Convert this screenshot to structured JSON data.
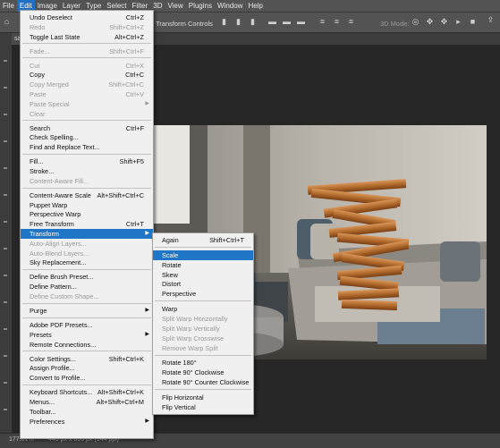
{
  "menubar": [
    "File",
    "Edit",
    "Image",
    "Layer",
    "Type",
    "Select",
    "Filter",
    "3D",
    "View",
    "Plugins",
    "Window",
    "Help"
  ],
  "menubar_active_index": 1,
  "optionsbar": {
    "transform_controls_label": "Transform Controls",
    "mode_3d_label": "3D Mode:"
  },
  "tab": {
    "label": "sa"
  },
  "status": {
    "zoom": "177.01%",
    "doc_info": "440 px x 303 px (144 ppi)"
  },
  "edit_menu": [
    {
      "label": "Undo Deselect",
      "shortcut": "Ctrl+Z",
      "disabled": false
    },
    {
      "label": "Redo",
      "shortcut": "Shift+Ctrl+Z",
      "disabled": true
    },
    {
      "label": "Toggle Last State",
      "shortcut": "Alt+Ctrl+Z",
      "disabled": false
    },
    {
      "sep": true
    },
    {
      "label": "Fade...",
      "shortcut": "Shift+Ctrl+F",
      "disabled": true
    },
    {
      "sep": true
    },
    {
      "label": "Cut",
      "shortcut": "Ctrl+X",
      "disabled": true
    },
    {
      "label": "Copy",
      "shortcut": "Ctrl+C",
      "disabled": false
    },
    {
      "label": "Copy Merged",
      "shortcut": "Shift+Ctrl+C",
      "disabled": true
    },
    {
      "label": "Paste",
      "shortcut": "Ctrl+V",
      "disabled": true
    },
    {
      "label": "Paste Special",
      "shortcut": "",
      "disabled": true,
      "submenu": true
    },
    {
      "label": "Clear",
      "shortcut": "",
      "disabled": true
    },
    {
      "sep": true
    },
    {
      "label": "Search",
      "shortcut": "Ctrl+F",
      "disabled": false
    },
    {
      "label": "Check Spelling...",
      "shortcut": "",
      "disabled": false
    },
    {
      "label": "Find and Replace Text...",
      "shortcut": "",
      "disabled": false
    },
    {
      "sep": true
    },
    {
      "label": "Fill...",
      "shortcut": "Shift+F5",
      "disabled": false
    },
    {
      "label": "Stroke...",
      "shortcut": "",
      "disabled": false
    },
    {
      "label": "Content-Aware Fill...",
      "shortcut": "",
      "disabled": true
    },
    {
      "sep": true
    },
    {
      "label": "Content-Aware Scale",
      "shortcut": "Alt+Shift+Ctrl+C",
      "disabled": false
    },
    {
      "label": "Puppet Warp",
      "shortcut": "",
      "disabled": false
    },
    {
      "label": "Perspective Warp",
      "shortcut": "",
      "disabled": false
    },
    {
      "label": "Free Transform",
      "shortcut": "Ctrl+T",
      "disabled": false
    },
    {
      "label": "Transform",
      "shortcut": "",
      "disabled": false,
      "submenu": true,
      "highlight": true
    },
    {
      "label": "Auto-Align Layers...",
      "shortcut": "",
      "disabled": true
    },
    {
      "label": "Auto-Blend Layers...",
      "shortcut": "",
      "disabled": true
    },
    {
      "label": "Sky Replacement...",
      "shortcut": "",
      "disabled": false
    },
    {
      "sep": true
    },
    {
      "label": "Define Brush Preset...",
      "shortcut": "",
      "disabled": false
    },
    {
      "label": "Define Pattern...",
      "shortcut": "",
      "disabled": false
    },
    {
      "label": "Define Custom Shape...",
      "shortcut": "",
      "disabled": true
    },
    {
      "sep": true
    },
    {
      "label": "Purge",
      "shortcut": "",
      "disabled": false,
      "submenu": true
    },
    {
      "sep": true
    },
    {
      "label": "Adobe PDF Presets...",
      "shortcut": "",
      "disabled": false
    },
    {
      "label": "Presets",
      "shortcut": "",
      "disabled": false,
      "submenu": true
    },
    {
      "label": "Remote Connections...",
      "shortcut": "",
      "disabled": false
    },
    {
      "sep": true
    },
    {
      "label": "Color Settings...",
      "shortcut": "Shift+Ctrl+K",
      "disabled": false
    },
    {
      "label": "Assign Profile...",
      "shortcut": "",
      "disabled": false
    },
    {
      "label": "Convert to Profile...",
      "shortcut": "",
      "disabled": false
    },
    {
      "sep": true
    },
    {
      "label": "Keyboard Shortcuts...",
      "shortcut": "Alt+Shift+Ctrl+K",
      "disabled": false
    },
    {
      "label": "Menus...",
      "shortcut": "Alt+Shift+Ctrl+M",
      "disabled": false
    },
    {
      "label": "Toolbar...",
      "shortcut": "",
      "disabled": false
    },
    {
      "label": "Preferences",
      "shortcut": "",
      "disabled": false,
      "submenu": true
    }
  ],
  "transform_menu": [
    {
      "label": "Again",
      "shortcut": "Shift+Ctrl+T",
      "disabled": false
    },
    {
      "sep": true
    },
    {
      "label": "Scale",
      "shortcut": "",
      "disabled": false,
      "highlight": true
    },
    {
      "label": "Rotate",
      "shortcut": "",
      "disabled": false
    },
    {
      "label": "Skew",
      "shortcut": "",
      "disabled": false
    },
    {
      "label": "Distort",
      "shortcut": "",
      "disabled": false
    },
    {
      "label": "Perspective",
      "shortcut": "",
      "disabled": false
    },
    {
      "sep": true
    },
    {
      "label": "Warp",
      "shortcut": "",
      "disabled": false
    },
    {
      "label": "Split Warp Horizontally",
      "shortcut": "",
      "disabled": true
    },
    {
      "label": "Split Warp Vertically",
      "shortcut": "",
      "disabled": true
    },
    {
      "label": "Split Warp Crosswise",
      "shortcut": "",
      "disabled": true
    },
    {
      "label": "Remove Warp Split",
      "shortcut": "",
      "disabled": true
    },
    {
      "sep": true
    },
    {
      "label": "Rotate 180°",
      "shortcut": "",
      "disabled": false
    },
    {
      "label": "Rotate 90° Clockwise",
      "shortcut": "",
      "disabled": false
    },
    {
      "label": "Rotate 90° Counter Clockwise",
      "shortcut": "",
      "disabled": false
    },
    {
      "sep": true
    },
    {
      "label": "Flip Horizontal",
      "shortcut": "",
      "disabled": false
    },
    {
      "label": "Flip Vertical",
      "shortcut": "",
      "disabled": false
    }
  ],
  "colors": {
    "highlight": "#1f76c6",
    "menu_bg": "#f0f0f0",
    "chrome": "#535353"
  }
}
